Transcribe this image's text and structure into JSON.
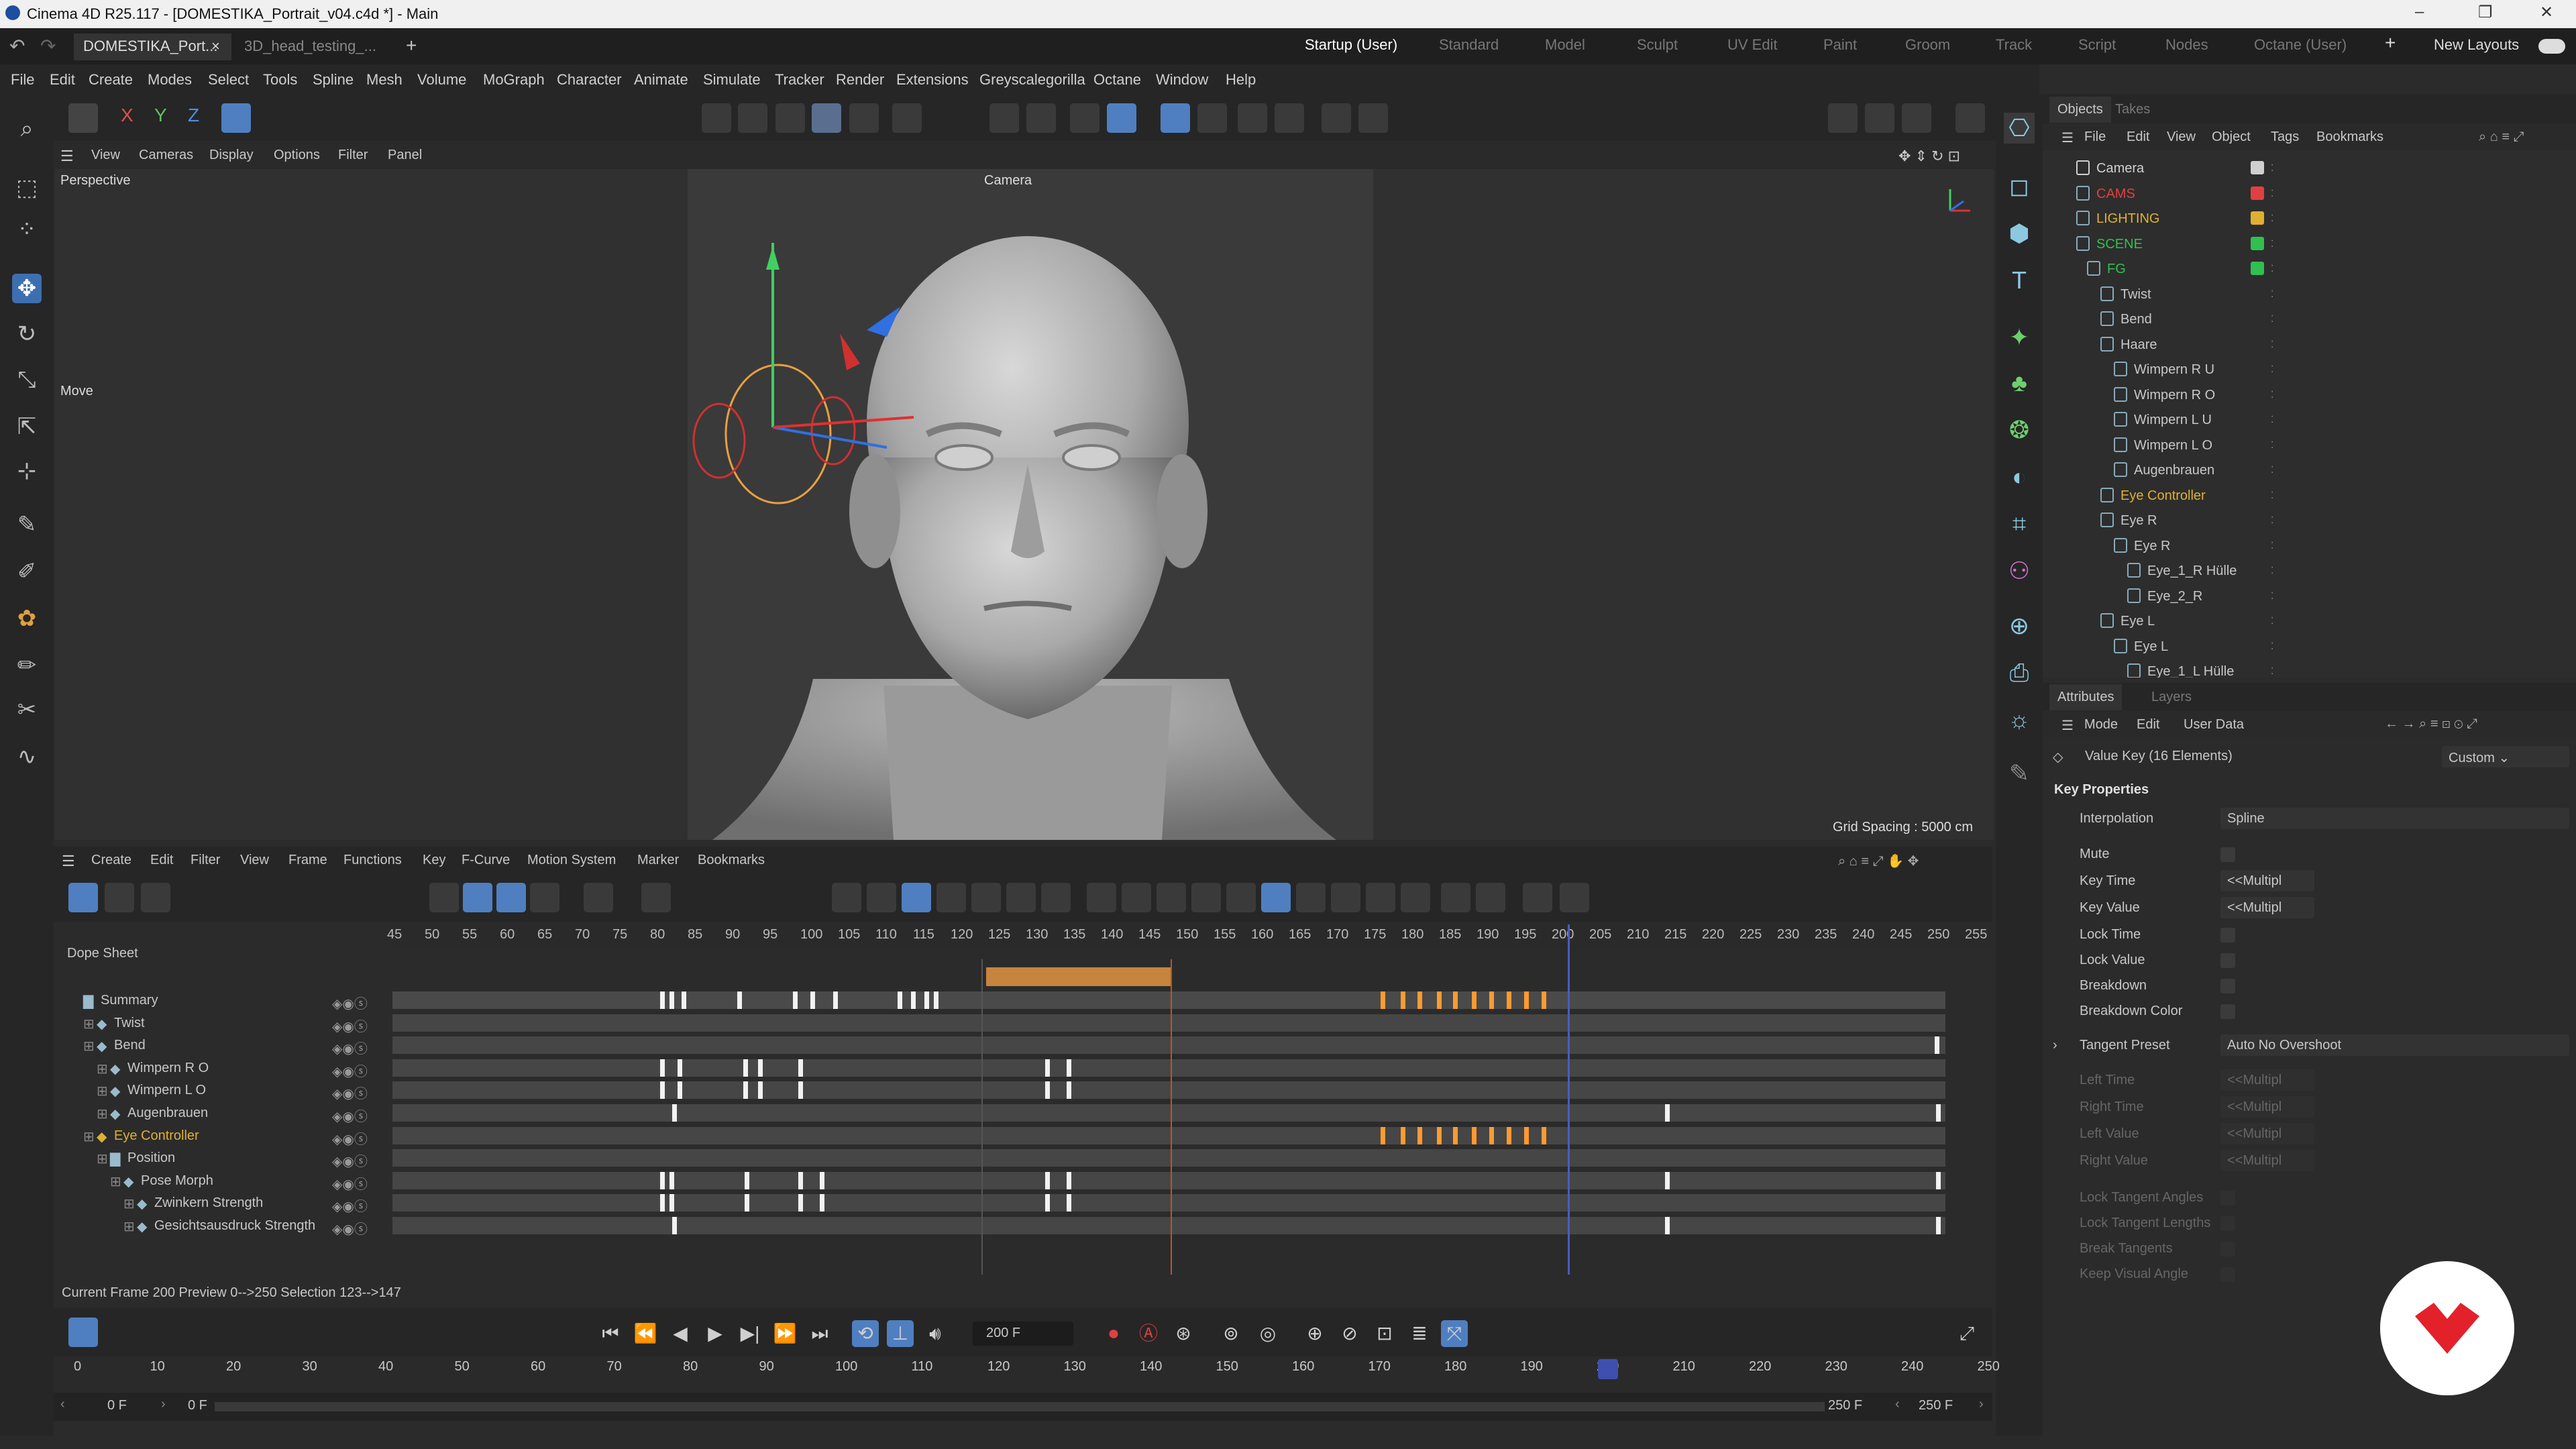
{
  "window": {
    "title": "Cinema 4D R25.117 - [DOMESTIKA_Portrait_v04.c4d *] - Main",
    "min": "–",
    "max": "❐",
    "close": "✕"
  },
  "tabs": {
    "doc1": "DOMESTIKA_Port...",
    "doc1_close": "×",
    "doc2": "3D_head_testing_...",
    "add": "+",
    "layouts": [
      "Startup (User)",
      "Standard",
      "Model",
      "Sculpt",
      "UV Edit",
      "Paint",
      "Groom",
      "Track",
      "Script",
      "Nodes",
      "Octane (User)"
    ],
    "layout_add": "+",
    "new_layouts": "New Layouts"
  },
  "menu": [
    "File",
    "Edit",
    "Create",
    "Modes",
    "Select",
    "Tools",
    "Spline",
    "Mesh",
    "Volume",
    "MoGraph",
    "Character",
    "Animate",
    "Simulate",
    "Tracker",
    "Render",
    "Extensions",
    "Greyscalegorilla",
    "Octane",
    "Window",
    "Help"
  ],
  "axes": {
    "x": "X",
    "y": "Y",
    "z": "Z"
  },
  "viewport": {
    "menu": [
      "View",
      "Cameras",
      "Display",
      "Options",
      "Filter",
      "Panel"
    ],
    "name": "Perspective",
    "camera": "Camera",
    "tool": "Move",
    "grid": "Grid Spacing : 5000 cm"
  },
  "objects": {
    "tabs": [
      "Objects",
      "Takes"
    ],
    "menu": [
      "File",
      "Edit",
      "View",
      "Object",
      "Tags",
      "Bookmarks"
    ],
    "rows": [
      {
        "name": "Camera",
        "color": "#d0d0d0"
      },
      {
        "name": "CAMS",
        "color": "#e04040"
      },
      {
        "name": "LIGHTING",
        "color": "#e0b030"
      },
      {
        "name": "SCENE",
        "color": "#30c050"
      },
      {
        "name": "FG",
        "color": "#30c050"
      },
      {
        "name": "Twist",
        "color": "#c8c8c8"
      },
      {
        "name": "Bend",
        "color": "#c8c8c8"
      },
      {
        "name": "Haare",
        "color": "#c8c8c8"
      },
      {
        "name": "Wimpern R U",
        "color": "#c8c8c8"
      },
      {
        "name": "Wimpern R O",
        "color": "#c8c8c8"
      },
      {
        "name": "Wimpern L U",
        "color": "#c8c8c8"
      },
      {
        "name": "Wimpern L O",
        "color": "#c8c8c8"
      },
      {
        "name": "Augenbrauen",
        "color": "#c8c8c8"
      },
      {
        "name": "Eye Controller",
        "color": "#e0b030"
      },
      {
        "name": "Eye R",
        "color": "#c8c8c8"
      },
      {
        "name": "Eye R",
        "color": "#c8c8c8"
      },
      {
        "name": "Eye_1_R Hülle",
        "color": "#c8c8c8"
      },
      {
        "name": "Eye_2_R",
        "color": "#c8c8c8"
      },
      {
        "name": "Eye L",
        "color": "#c8c8c8"
      },
      {
        "name": "Eye L",
        "color": "#c8c8c8"
      },
      {
        "name": "Eye_1_L Hülle",
        "color": "#c8c8c8"
      }
    ]
  },
  "attributes": {
    "tabs": [
      "Attributes",
      "Layers"
    ],
    "menu": [
      "Mode",
      "Edit",
      "User Data"
    ],
    "title": "Value Key (16 Elements)",
    "preset": "Custom",
    "section": "Key Properties",
    "interpolation_label": "Interpolation",
    "interpolation": "Spline",
    "mute": "Mute",
    "key_time": "Key Time",
    "key_value": "Key Value",
    "multi": "<<Multipl",
    "lock_time": "Lock Time",
    "lock_value": "Lock Value",
    "breakdown": "Breakdown",
    "breakdown_color": "Breakdown Color",
    "tangent_preset_label": "Tangent Preset",
    "tangent_preset": "Auto No Overshoot",
    "left_time": "Left Time",
    "right_time": "Right Time",
    "left_value": "Left Value",
    "right_value": "Right Value",
    "lock_tangent_angles": "Lock Tangent Angles",
    "lock_tangent_lengths": "Lock Tangent Lengths",
    "break_tangents": "Break Tangents",
    "keep_visual_angle": "Keep Visual Angle"
  },
  "timeline": {
    "menu": [
      "Create",
      "Edit",
      "Filter",
      "View",
      "Frame",
      "Functions",
      "Key",
      "F-Curve",
      "Motion System",
      "Marker",
      "Bookmarks"
    ],
    "title": "Dope Sheet",
    "ruler": [
      "45",
      "50",
      "55",
      "60",
      "65",
      "70",
      "75",
      "80",
      "85",
      "90",
      "95",
      "100",
      "105",
      "110",
      "115",
      "120",
      "125",
      "130",
      "135",
      "140",
      "145",
      "150",
      "155",
      "160",
      "165",
      "170",
      "175",
      "180",
      "185",
      "190",
      "195",
      "200",
      "205",
      "210",
      "215",
      "220",
      "225",
      "230",
      "235",
      "240",
      "245",
      "250",
      "255"
    ],
    "tracks": [
      "Summary",
      "Twist",
      "Bend",
      "Wimpern R O",
      "Wimpern L O",
      "Augenbrauen",
      "Eye Controller",
      "Position",
      "Pose Morph",
      "Zwinkern Strength",
      "Gesichtsausdruck Strength"
    ],
    "status": "Current Frame  200  Preview  0-->250   Selection 123-->147"
  },
  "transport": {
    "frame": "200 F",
    "start": "0 F",
    "start2": "0 F",
    "end": "250 F",
    "end2": "250 F",
    "ruler": [
      "0",
      "10",
      "20",
      "30",
      "40",
      "50",
      "60",
      "70",
      "80",
      "90",
      "100",
      "110",
      "120",
      "130",
      "140",
      "150",
      "160",
      "170",
      "180",
      "190",
      "200",
      "210",
      "220",
      "230",
      "240",
      "250"
    ]
  }
}
